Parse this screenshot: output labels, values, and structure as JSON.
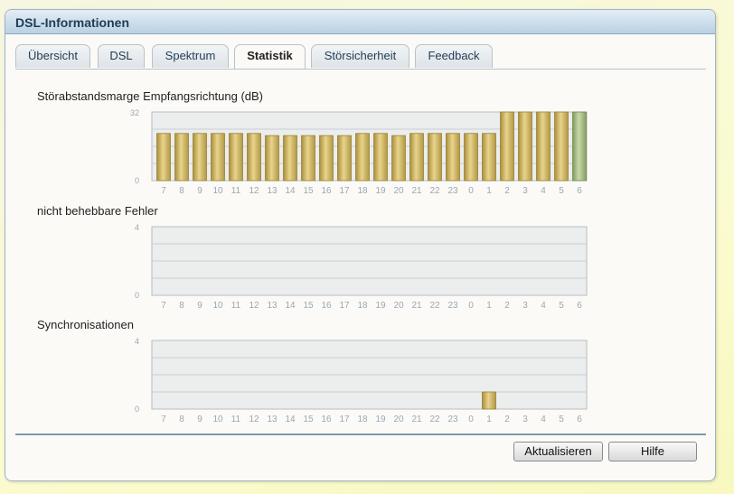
{
  "window": {
    "title": "DSL-Informationen"
  },
  "tabs": [
    {
      "label": "Übersicht",
      "active": false
    },
    {
      "label": "DSL",
      "active": false
    },
    {
      "label": "Spektrum",
      "active": false
    },
    {
      "label": "Statistik",
      "active": true
    },
    {
      "label": "Störsicherheit",
      "active": false
    },
    {
      "label": "Feedback",
      "active": false
    }
  ],
  "buttons": {
    "refresh": "Aktualisieren",
    "help": "Hilfe"
  },
  "colors": {
    "bar_gold": "#c8b060",
    "bar_green": "#a6bb84",
    "grid_bg": "#eceded",
    "grid_line": "#c8cfd6",
    "axis_text": "#9aa7b4"
  },
  "chart_data": [
    {
      "type": "bar",
      "title": "Störabstandsmarge Empfangsrichtung (dB)",
      "categories": [
        "7",
        "8",
        "9",
        "10",
        "11",
        "12",
        "13",
        "14",
        "15",
        "16",
        "17",
        "18",
        "19",
        "20",
        "21",
        "22",
        "23",
        "0",
        "1",
        "2",
        "3",
        "4",
        "5",
        "6"
      ],
      "values": [
        22,
        22,
        22,
        22,
        22,
        22,
        21,
        21,
        21,
        21,
        21,
        22,
        22,
        21,
        22,
        22,
        22,
        22,
        22,
        32,
        32,
        32,
        32,
        32
      ],
      "highlight_last": true,
      "ylim": [
        0,
        32
      ],
      "yticks": [
        "32",
        "0"
      ],
      "grid": true
    },
    {
      "type": "bar",
      "title": "nicht behebbare Fehler",
      "categories": [
        "7",
        "8",
        "9",
        "10",
        "11",
        "12",
        "13",
        "14",
        "15",
        "16",
        "17",
        "18",
        "19",
        "20",
        "21",
        "22",
        "23",
        "0",
        "1",
        "2",
        "3",
        "4",
        "5",
        "6"
      ],
      "values": [
        0,
        0,
        0,
        0,
        0,
        0,
        0,
        0,
        0,
        0,
        0,
        0,
        0,
        0,
        0,
        0,
        0,
        0,
        0,
        0,
        0,
        0,
        0,
        0
      ],
      "highlight_last": false,
      "ylim": [
        0,
        4
      ],
      "yticks": [
        "4",
        "0"
      ],
      "grid": true
    },
    {
      "type": "bar",
      "title": "Synchronisationen",
      "categories": [
        "7",
        "8",
        "9",
        "10",
        "11",
        "12",
        "13",
        "14",
        "15",
        "16",
        "17",
        "18",
        "19",
        "20",
        "21",
        "22",
        "23",
        "0",
        "1",
        "2",
        "3",
        "4",
        "5",
        "6"
      ],
      "values": [
        0,
        0,
        0,
        0,
        0,
        0,
        0,
        0,
        0,
        0,
        0,
        0,
        0,
        0,
        0,
        0,
        0,
        0,
        1,
        0,
        0,
        0,
        0,
        0
      ],
      "highlight_last": false,
      "ylim": [
        0,
        4
      ],
      "yticks": [
        "4",
        "0"
      ],
      "grid": true
    }
  ]
}
